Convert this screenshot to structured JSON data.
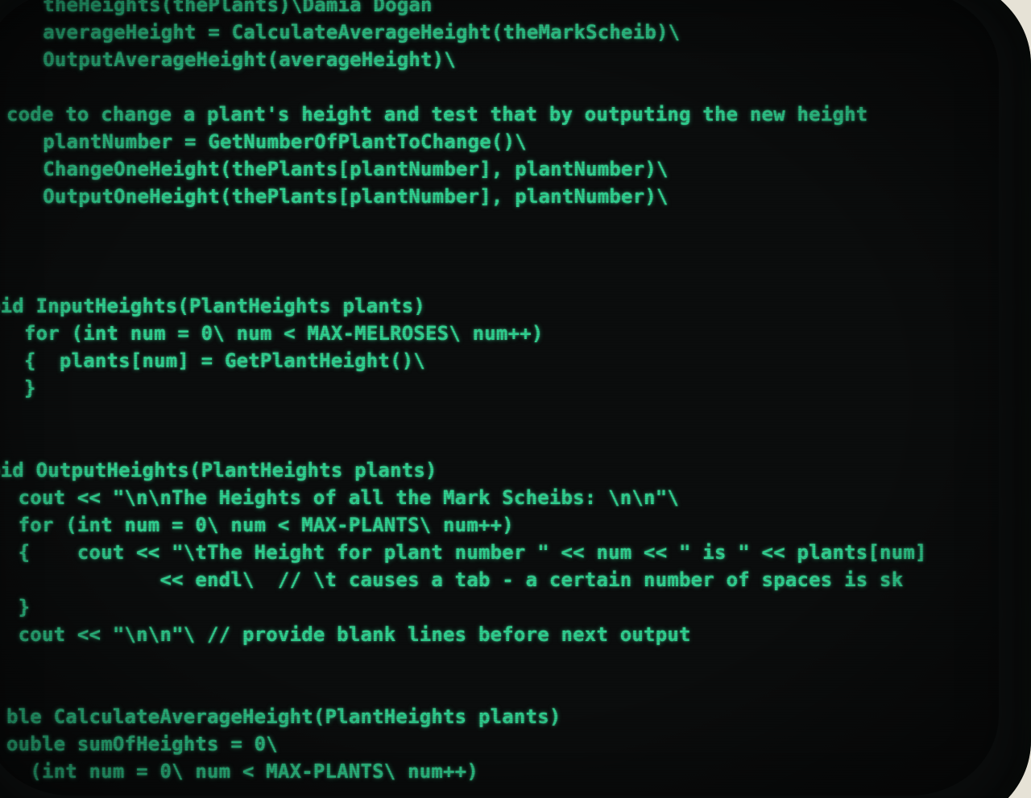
{
  "screen": {
    "lines": [
      "     theHeights(thePlants)\\Damia Dogan",
      "     averageHeight = CalculateAverageHeight(theMarkScheib)\\",
      "     OutputAverageHeight(averageHeight)\\",
      "",
      "code to change a plant's height and test that by outputing the new height",
      "     plantNumber = GetNumberOfPlantToChange()\\",
      "     ChangeOneHeight(thePlants[plantNumber], plantNumber)\\",
      "     OutputOneHeight(thePlants[plantNumber], plantNumber)\\",
      "",
      "",
      "",
      "oid InputHeights(PlantHeights plants)",
      "   for (int num = 0\\ num < MAX-MELROSES\\ num++)",
      "   {  plants[num] = GetPlantHeight()\\",
      "   }",
      "",
      "",
      "",
      "oid OutputHeights(PlantHeights plants)",
      " cout << \"\\n\\nThe Heights of all the Mark Scheibs: \\n\\n\"\\",
      " for (int num = 0\\ num < MAX-PLANTS\\ num++)",
      " {    cout << \"\\tThe Height for plant number \" << num << \" is \" << plants[num]",
      "             << endl\\  // \\t causes a tab - a certain number of spaces is sk",
      " }",
      " cout << \"\\n\\n\"\\ // provide blank lines before next output",
      "",
      "",
      "",
      "ble CalculateAverageHeight(PlantHeights plants)",
      "ouble sumOfHeights = 0\\",
      "  (int num = 0\\ num < MAX-PLANTS\\ num++)"
    ]
  },
  "colors": {
    "phosphor": "#2fcf8f",
    "screen": "#0b0d0d",
    "bezel": "#e6e2d6"
  }
}
